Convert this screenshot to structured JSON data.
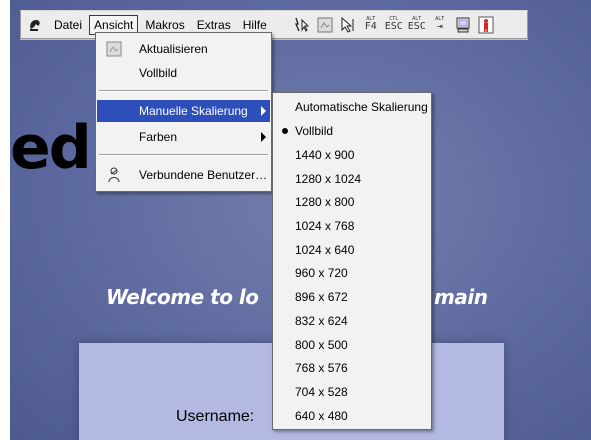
{
  "toolbar": {
    "menus": [
      "Datei",
      "Ansicht",
      "Makros",
      "Extras",
      "Hilfe"
    ],
    "open_menu": "Ansicht",
    "tools": [
      {
        "icon": "pointer-lightning-icon"
      },
      {
        "icon": "image-refresh-icon"
      },
      {
        "icon": "cursor-arrow-icon"
      },
      {
        "icon": "alt-f4-key-icon",
        "top": "ALT",
        "bottom": "F4"
      },
      {
        "icon": "ctrl-esc-key-icon",
        "top": "CTL",
        "bottom": "ESC"
      },
      {
        "icon": "alt-esc-key-icon",
        "top": "ALT",
        "bottom": "ESC"
      },
      {
        "icon": "alt-tab-key-icon",
        "top": "ALT",
        "bottom": "⇥"
      },
      {
        "icon": "monitor-icon"
      },
      {
        "icon": "user-figure-icon"
      }
    ]
  },
  "ansicht_menu": {
    "items": [
      {
        "label": "Aktualisieren",
        "icon": "refresh-icon"
      },
      {
        "label": "Vollbild"
      },
      {
        "label": "Manuelle Skalierung",
        "submenu": true,
        "selected": true
      },
      {
        "label": "Farben",
        "submenu": true
      },
      {
        "label": "Verbundene Benutzer…",
        "icon": "users-icon"
      }
    ]
  },
  "scaling_submenu": {
    "items": [
      "Automatische Skalierung",
      "Vollbild",
      "1440 x 900",
      "1280 x 1024",
      "1280 x 800",
      "1024 x 768",
      "1024 x 640",
      "960 x 720",
      "896 x 672",
      "832 x 624",
      "800 x 500",
      "768 x 576",
      "704 x 528",
      "640 x 480"
    ],
    "checked": "Vollbild"
  },
  "remote_desktop": {
    "logo_fragment": "ed",
    "welcome_left": "Welcome to lo",
    "welcome_right": "main",
    "username_label": "Username:"
  },
  "colors": {
    "selection": "#2e4fba",
    "background": "#5d6a9f",
    "login_panel": "#b3b9e3"
  }
}
